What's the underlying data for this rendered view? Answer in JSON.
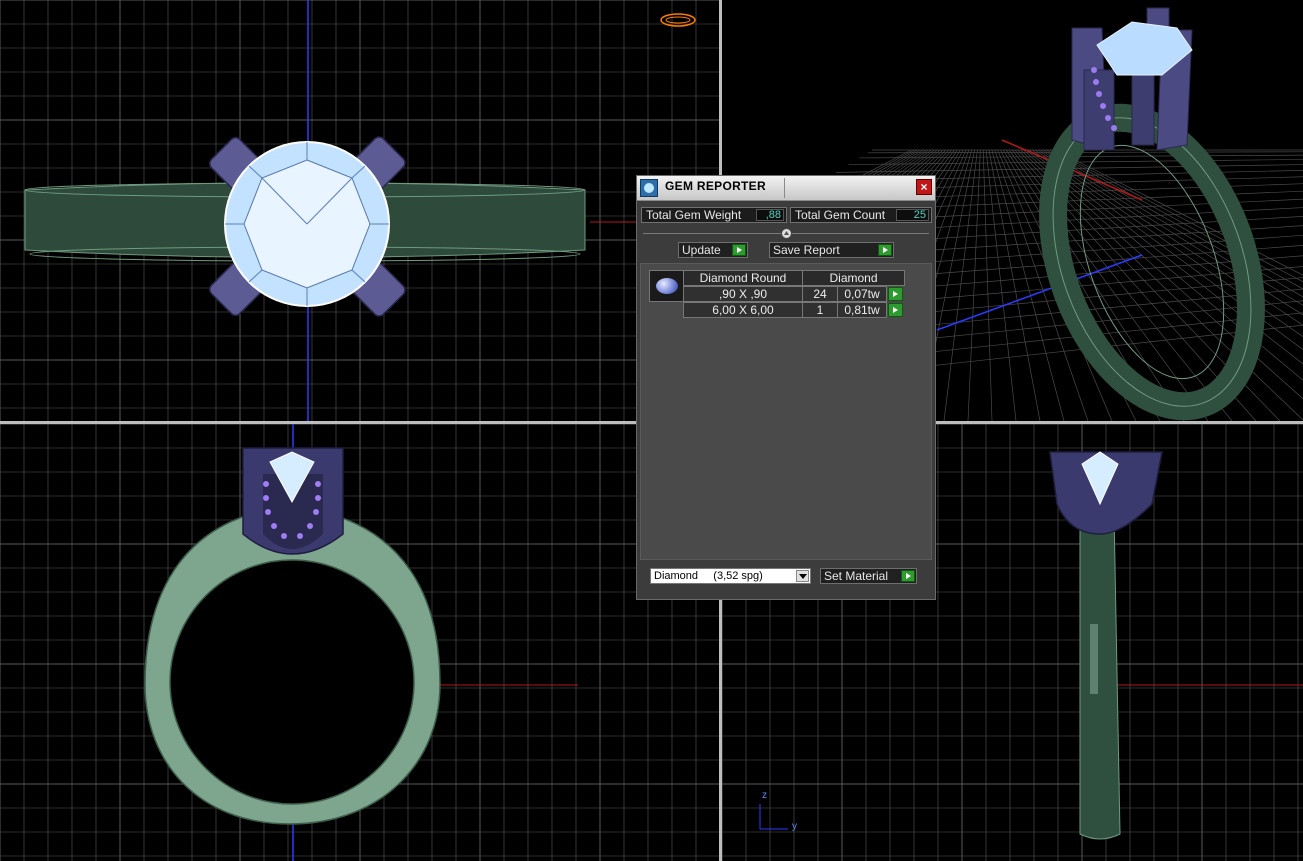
{
  "gem_reporter": {
    "title": "GEM REPORTER",
    "close_glyph": "×",
    "total_gem_weight_label": "Total Gem Weight",
    "total_gem_weight_value": ",88",
    "total_gem_count_label": "Total Gem Count",
    "total_gem_count_value": "25",
    "update_label": "Update",
    "save_report_label": "Save Report",
    "table": {
      "headers": [
        "Diamond Round",
        "Diamond"
      ],
      "rows": [
        {
          "size": ",90 X ,90",
          "count": "24",
          "weight": "0,07tw"
        },
        {
          "size": "6,00 X 6,00",
          "count": "1",
          "weight": "0,81tw"
        }
      ]
    },
    "material_select_value": "Diamond     (3,52 spg)",
    "set_material_label": "Set Material"
  },
  "viewports": {
    "bottom_right_axis": {
      "z_label": "z",
      "y_label": "y"
    }
  },
  "colors": {
    "ring_metal": "#2f4f3f",
    "ring_metal_light": "#7ea58e",
    "prong": "#4b4a82",
    "gem": "#b9dcff",
    "accent_go": "#2f9a2f",
    "value_text": "#4fd4c4"
  },
  "icons": {
    "app": "gem-reporter-app-icon",
    "close": "close-icon",
    "go": "play-arrow-icon",
    "dropdown": "chevron-down-icon",
    "gem_thumbnail": "round-diamond-icon"
  }
}
